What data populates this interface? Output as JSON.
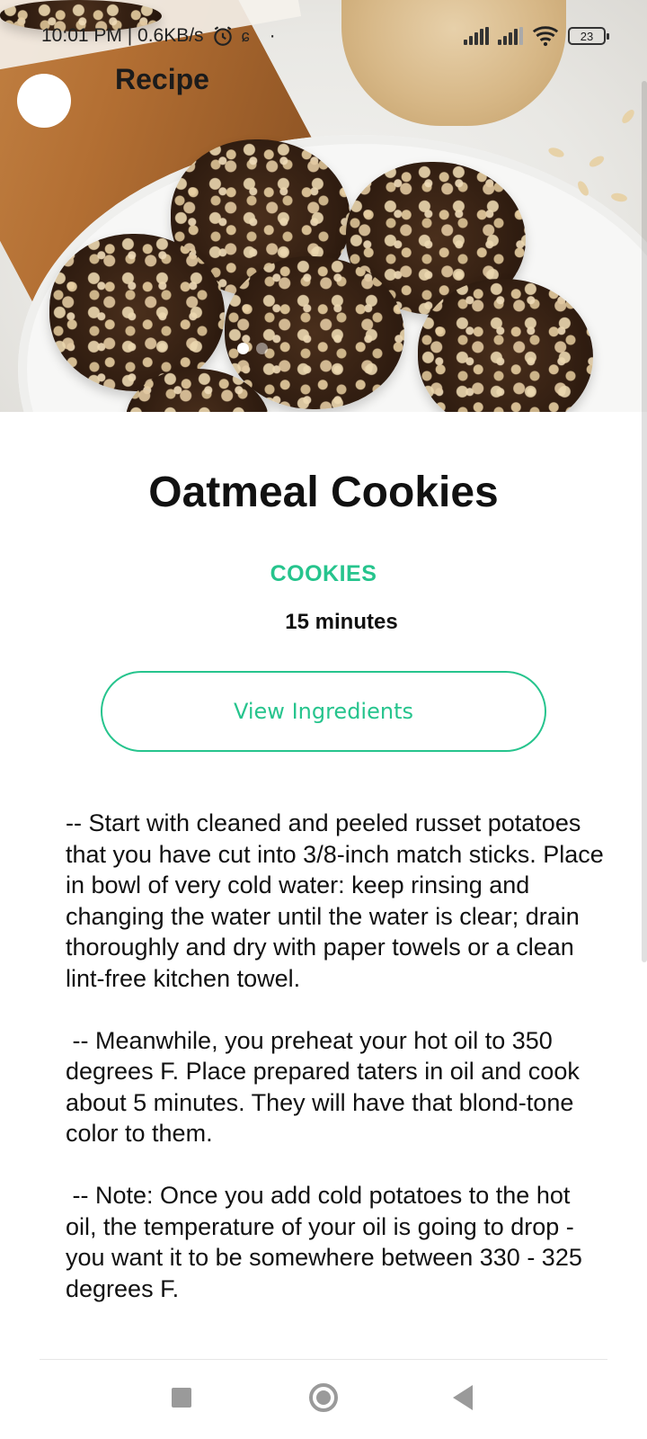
{
  "status_bar": {
    "time_speed": "10:01 PM | 0.6KB/s",
    "battery": "23",
    "icons": [
      "alarm-icon",
      "notification-icon",
      "dot-icon",
      "signal-icon",
      "wifi-icon",
      "battery-icon"
    ]
  },
  "app_bar": {
    "title": "Recipe"
  },
  "hero": {
    "image_subject": "chocolate oatmeal cookies on a white plate",
    "carousel_dots": 2,
    "active_dot": 0
  },
  "recipe": {
    "title": "Oatmeal Cookies",
    "category": "COOKIES",
    "duration": "15 minutes",
    "view_ingredients_label": "View Ingredients",
    "instructions": "-- Start with cleaned and peeled russet potatoes that you have cut into 3/8-inch match sticks. Place in bowl of very cold water: keep rinsing and changing the water until the water is clear; drain thoroughly and dry with paper towels or a clean lint-free kitchen towel.\n\n -- Meanwhile, you preheat your hot oil to 350 degrees F. Place prepared taters in oil and cook about 5 minutes. They will have that blond-tone color to them.\n\n -- Note: Once you add cold potatoes to the hot oil, the temperature of your oil is going to drop - you want it to be somewhere between 330 - 325 degrees F."
  },
  "colors": {
    "accent": "#26c48d",
    "text": "#111111",
    "nav_icons": "#9a9a9a"
  },
  "nav": {
    "buttons": [
      "recents-button",
      "home-button",
      "back-button"
    ]
  }
}
